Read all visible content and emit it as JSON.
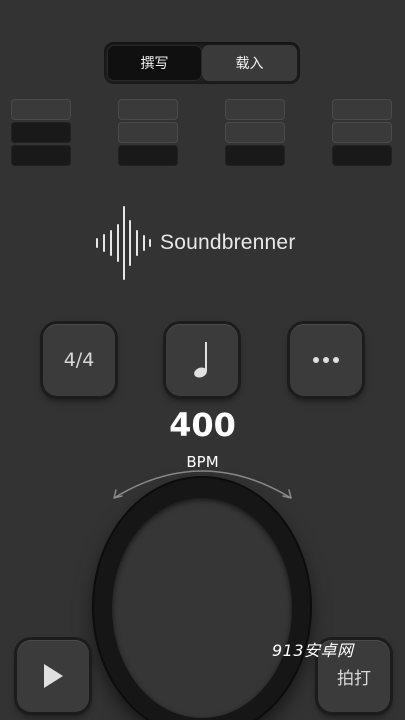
{
  "tabs": [
    {
      "label": "撰写",
      "active": true
    },
    {
      "label": "载入",
      "active": false
    }
  ],
  "beats": [
    {
      "levels": [
        "off",
        "on",
        "on"
      ]
    },
    {
      "levels": [
        "off",
        "off",
        "on"
      ]
    },
    {
      "levels": [
        "off",
        "off",
        "on"
      ]
    },
    {
      "levels": [
        "off",
        "off",
        "on"
      ]
    }
  ],
  "logo": {
    "text": "Soundbrenner"
  },
  "controls": {
    "time_signature": "4/4",
    "note_icon": "quarter-note-icon",
    "more_icon": "more-icon"
  },
  "tempo": {
    "value": "400",
    "unit": "BPM"
  },
  "bottom": {
    "play_icon": "play-icon",
    "tap_label": "拍打"
  },
  "watermark": "913安卓网",
  "colors": {
    "background": "#333333",
    "active_cell": "#191919",
    "inactive_cell": "#3a3a3a"
  }
}
